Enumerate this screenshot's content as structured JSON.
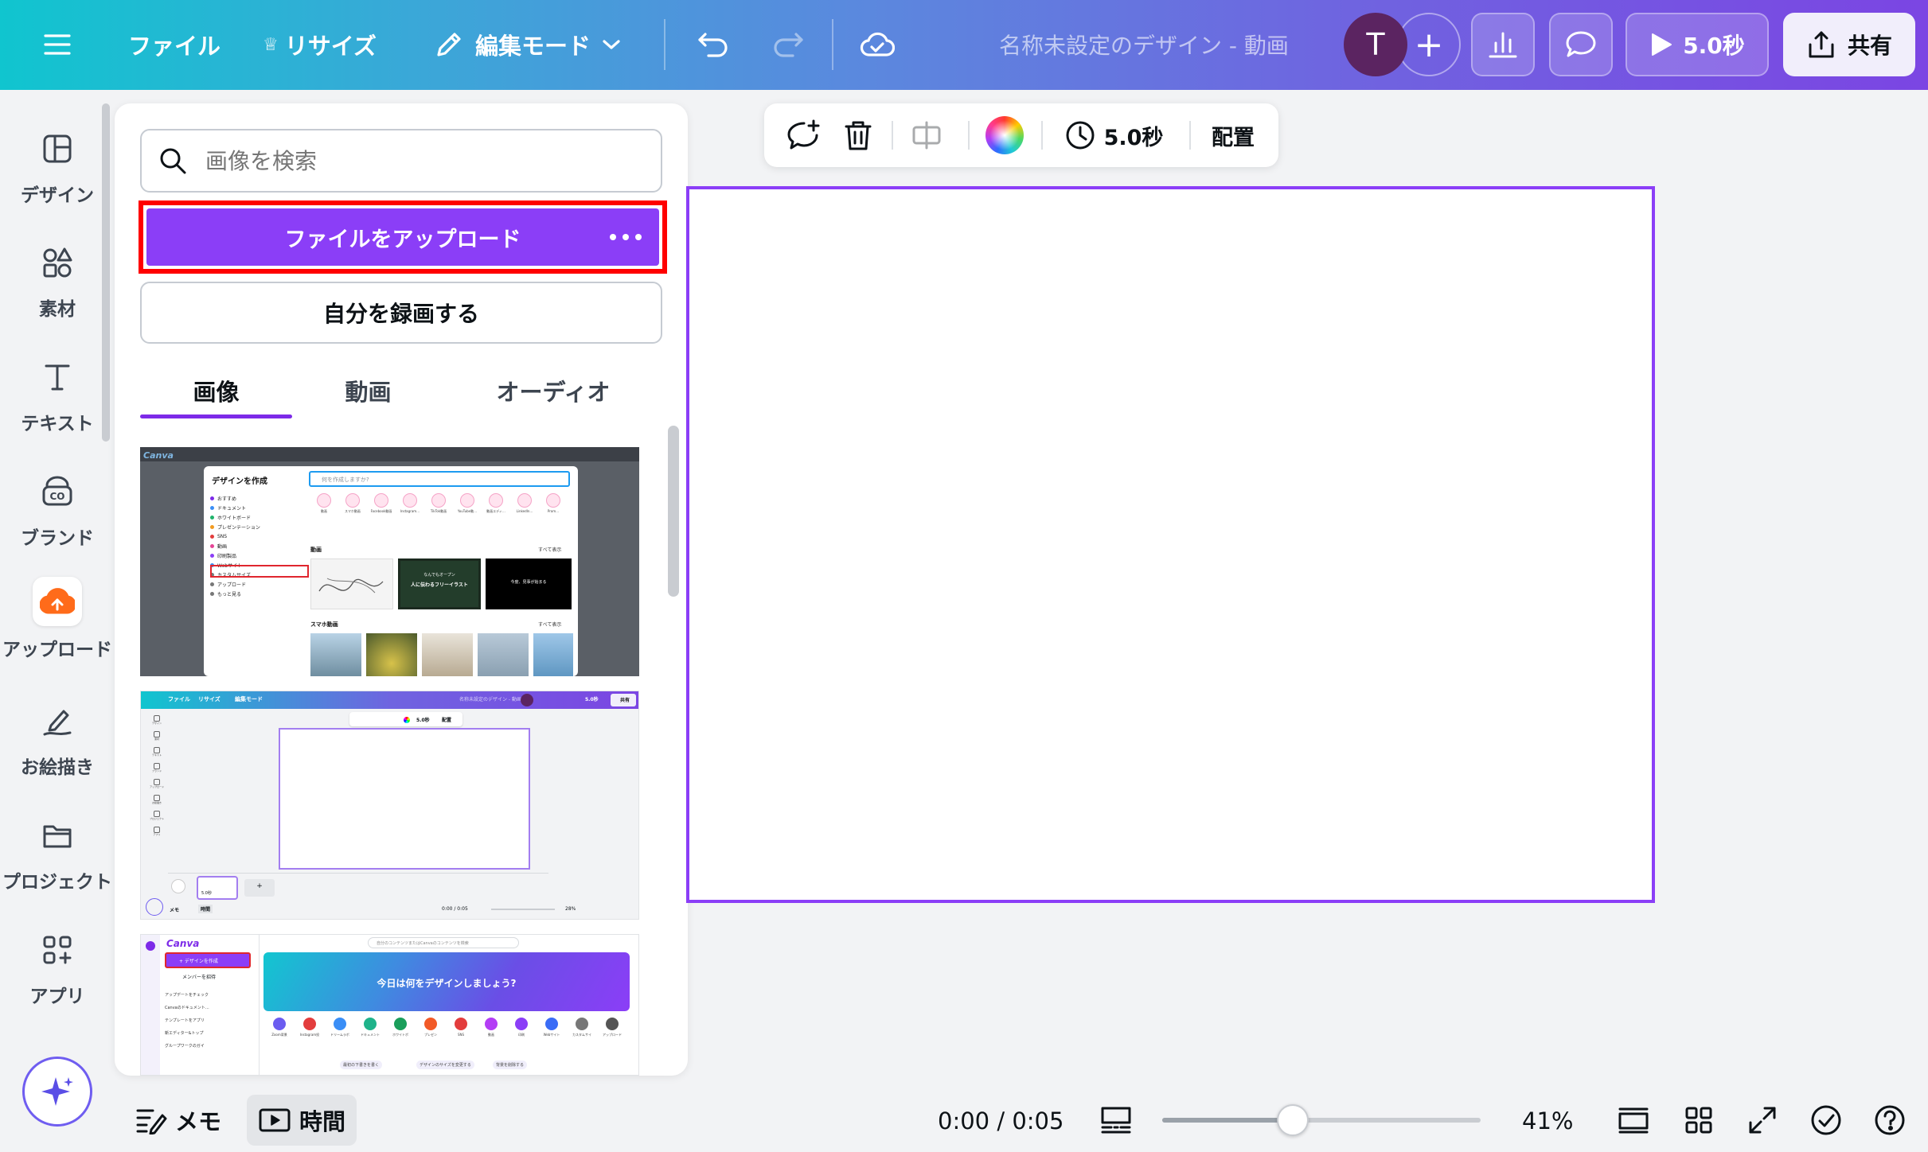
{
  "topbar": {
    "file": "ファイル",
    "resize": "リサイズ",
    "edit_mode": "編集モード",
    "doc_title": "名称未設定のデザイン - 動画",
    "avatar_initial": "T",
    "add_symbol": "+",
    "present_label": "5.0秒",
    "share": "共有",
    "gradient_start": "#10c5cf",
    "gradient_end": "#7b45e3"
  },
  "rail": {
    "items": [
      {
        "label": "デザイン",
        "icon": "layout-icon"
      },
      {
        "label": "素材",
        "icon": "shapes-icon"
      },
      {
        "label": "テキスト",
        "icon": "text-icon"
      },
      {
        "label": "ブランド",
        "icon": "brand-icon"
      },
      {
        "label": "アップロード",
        "icon": "upload-cloud-icon"
      },
      {
        "label": "お絵描き",
        "icon": "draw-icon"
      },
      {
        "label": "プロジェクト",
        "icon": "folder-icon"
      },
      {
        "label": "アプリ",
        "icon": "apps-icon"
      }
    ]
  },
  "panel": {
    "search_placeholder": "画像を検索",
    "upload_button": "ファイルをアップロード",
    "record_button": "自分を録画する",
    "tabs": [
      "画像",
      "動画",
      "オーディオ"
    ],
    "active_tab": "画像",
    "accent": "#8b3ef7",
    "highlight": "#ff0000",
    "thumbnails": {
      "t1": {
        "create_title": "デザインを作成",
        "search_ph": "何を作成しますか?",
        "menu": [
          "おすすめ",
          "ドキュメント",
          "ホワイトボード",
          "プレゼンテーション",
          "SNS",
          "動画",
          "印刷製品",
          "Webサイト",
          "カスタムサイズ",
          "アップロード",
          "もっと見る"
        ],
        "cat_icons": [
          "動画",
          "スマホ動画",
          "Facebook動画",
          "Instagram…",
          "TikTok動画",
          "YouTube動…",
          "動画エディ…",
          "LinkedIn…",
          "Prom…"
        ],
        "section1": "動画",
        "see_all": "すべて表示",
        "section2": "スマホ動画",
        "card2_line1": "なんでもオープン",
        "card2_line2": "人に伝わるフリーイラスト",
        "card3_text": "今度、見事が始まる",
        "brand": "Canva"
      },
      "t2": {
        "file": "ファイル",
        "resize": "リサイズ",
        "edit": "編集モード",
        "title": "名称未設定のデザイン - 動画",
        "share": "共有",
        "present": "5.0秒",
        "duration": "5.0秒",
        "arrange": "配置",
        "rail": [
          "デザイン",
          "素材",
          "テキスト",
          "ブランド",
          "アップロード",
          "お絵描き",
          "プロジェクト",
          "アプリ"
        ],
        "clip": "5.0秒",
        "add": "+",
        "notes": "メモ",
        "time": "時間",
        "timecode": "0:00 / 0:05",
        "zoom": "28%"
      },
      "t3": {
        "brand": "Canva",
        "create": "+ デザインを作成",
        "invite": "メンバーを招待",
        "search_ph": "自分のコンテンツまたはCanvaのコンテンツを検索",
        "hero": "今日は何をデザインしましょう?",
        "side_items": [
          "アップデートをチェック",
          "Canvaのドキュメント…",
          "テンプレートをアプリ",
          "新エディター&トップ",
          "グループワークのガイ"
        ],
        "icons": [
          "Zoom背景",
          "Instagram投",
          "ドリームラボ",
          "ドキュメント",
          "ホワイトボ",
          "プレゼン",
          "SNS",
          "動画",
          "印刷",
          "Webサイト",
          "カスタムサイ",
          "アップロード"
        ],
        "chips": [
          "最初の下書きを書く",
          "デザインのサイズを変更する",
          "背景を削除する"
        ]
      }
    }
  },
  "floating_toolbar": {
    "duration": "5.0秒",
    "arrange": "配置"
  },
  "bottom": {
    "notes": "メモ",
    "time": "時間",
    "timecode": "0:00 / 0:05",
    "zoom_label": "41%",
    "zoom_value": 0.41
  }
}
